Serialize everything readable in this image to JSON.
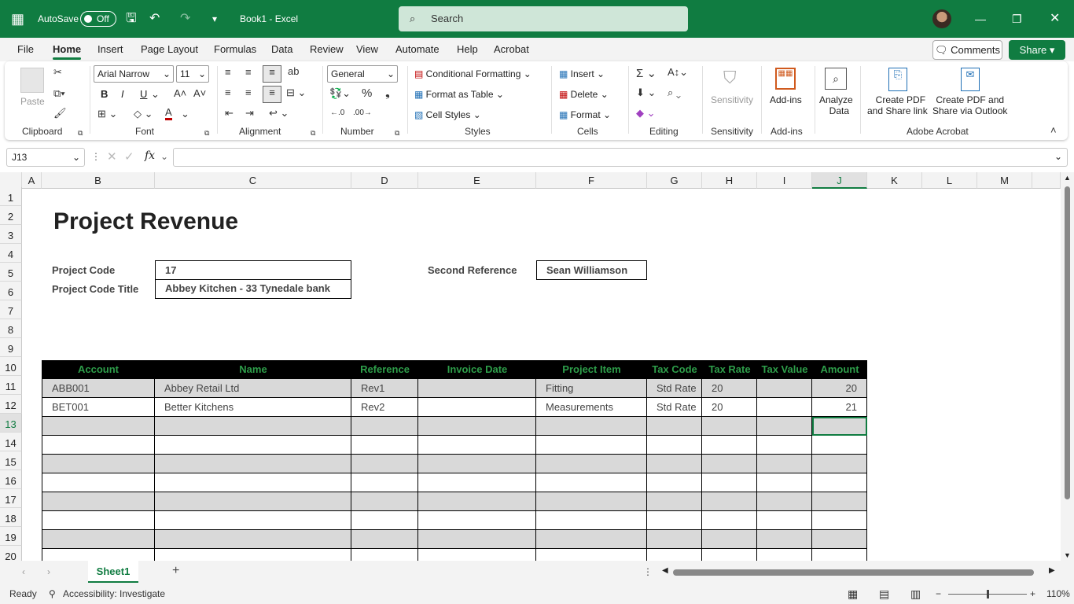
{
  "titlebar": {
    "autosave_label": "AutoSave",
    "autosave_state": "Off",
    "doc_title": "Book1  -  Excel",
    "search_placeholder": "Search"
  },
  "menu": {
    "tabs": [
      "File",
      "Home",
      "Insert",
      "Page Layout",
      "Formulas",
      "Data",
      "Review",
      "View",
      "Automate",
      "Help",
      "Acrobat"
    ],
    "active": "Home",
    "comments_label": "Comments",
    "share_label": "Share"
  },
  "ribbon": {
    "clipboard": {
      "paste": "Paste",
      "label": "Clipboard"
    },
    "font": {
      "name": "Arial Narrow",
      "size": "11",
      "bold": "B",
      "italic": "I",
      "underline": "U",
      "label": "Font"
    },
    "alignment": {
      "label": "Alignment"
    },
    "number": {
      "format": "General",
      "label": "Number"
    },
    "styles": {
      "conditional": "Conditional Formatting",
      "table": "Format as Table",
      "cell": "Cell Styles",
      "label": "Styles"
    },
    "cells": {
      "insert": "Insert",
      "delete": "Delete",
      "format": "Format",
      "label": "Cells"
    },
    "editing": {
      "label": "Editing"
    },
    "sensitivity": {
      "button": "Sensitivity",
      "label": "Sensitivity"
    },
    "addins": {
      "button": "Add-ins",
      "label": "Add-ins"
    },
    "analyze": {
      "line1": "Analyze",
      "line2": "Data"
    },
    "acrobat": {
      "create1": "Create PDF",
      "create2": "and Share link",
      "outlook1": "Create PDF and",
      "outlook2": "Share via Outlook",
      "label": "Adobe Acrobat"
    }
  },
  "formula_bar": {
    "name_box": "J13",
    "fx": "fx",
    "value": ""
  },
  "grid": {
    "columns": [
      "A",
      "B",
      "C",
      "D",
      "E",
      "F",
      "G",
      "H",
      "I",
      "J",
      "K",
      "L",
      "M"
    ],
    "selected_column": "J",
    "rows": [
      "1",
      "2",
      "3",
      "4",
      "5",
      "6",
      "7",
      "8",
      "9",
      "10",
      "11",
      "12",
      "13",
      "14",
      "15",
      "16",
      "17",
      "18",
      "19",
      "20"
    ],
    "selected_row": "13"
  },
  "sheet": {
    "title": "Project Revenue",
    "project_code_label": "Project Code",
    "project_code_value": "17",
    "project_title_label": "Project Code Title",
    "project_title_value": "Abbey Kitchen - 33 Tynedale bank",
    "second_ref_label": "Second Reference",
    "second_ref_value": "Sean Williamson",
    "table_headers": [
      "Account",
      "Name",
      "Reference",
      "Invoice Date",
      "Project Item",
      "Tax Code",
      "Tax Rate",
      "Tax Value",
      "Amount"
    ],
    "table_rows": [
      [
        "ABB001",
        "Abbey Retail Ltd",
        "Rev1",
        "",
        "Fitting",
        "Std Rate",
        "20",
        "",
        "20"
      ],
      [
        "BET001",
        "Better Kitchens",
        "Rev2",
        "",
        "Measurements",
        "Std Rate",
        "20",
        "",
        "21"
      ]
    ]
  },
  "sheet_tabs": {
    "active": "Sheet1"
  },
  "status": {
    "ready": "Ready",
    "accessibility": "Accessibility: Investigate",
    "zoom": "110%"
  }
}
